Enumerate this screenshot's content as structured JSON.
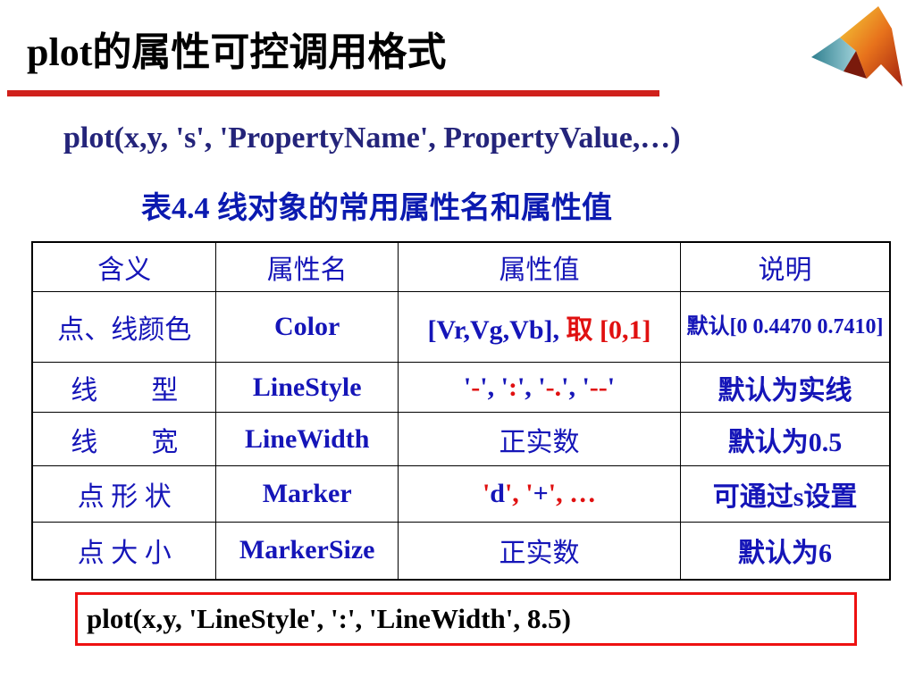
{
  "title": "plot的属性可控调用格式",
  "syntax": "plot(x,y, 's', 'PropertyName', PropertyValue,…)",
  "caption": "表4.4 线对象的常用属性名和属性值",
  "table": {
    "headers": [
      "含义",
      "属性名",
      "属性值",
      "说明"
    ],
    "rows": [
      {
        "meaning": "点、线颜色",
        "name": "Color",
        "value_main": "[Vr,Vg,Vb],",
        "value_red": "取 [0,1]",
        "note": "默认[0 0.4470 0.7410]"
      },
      {
        "meaning": "线　　型",
        "name": "LineStyle",
        "value_parts": [
          "'",
          "-",
          "', '",
          ":",
          "', '",
          "-.",
          "', '",
          "--",
          "'"
        ],
        "note": "默认为实线"
      },
      {
        "meaning": "线　　宽",
        "name": "LineWidth",
        "value": "正实数",
        "note": "默认为0.5"
      },
      {
        "meaning": "点 形 状",
        "name": "Marker",
        "value_parts": [
          "'",
          "d",
          "', '",
          "+",
          "', …"
        ],
        "note": "可通过s设置"
      },
      {
        "meaning": "点 大 小",
        "name": "MarkerSize",
        "value": "正实数",
        "note": "默认为6"
      }
    ]
  },
  "example": "plot(x,y, 'LineStyle', ':', 'LineWidth', 8.5)",
  "colors": {
    "accent_red": "#d0201b",
    "text_blue": "#1515b8",
    "caption_blue": "#0b1ab0",
    "syntax_navy": "#24247a"
  },
  "logo": "matlab-membrane-logo"
}
